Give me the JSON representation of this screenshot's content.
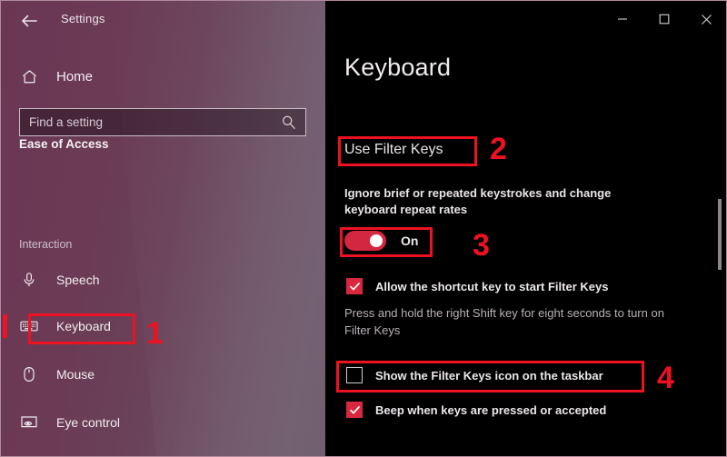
{
  "window": {
    "title": "Settings",
    "back_icon": "back-arrow-icon",
    "controls": [
      {
        "name": "minimize-button",
        "glyph": "—"
      },
      {
        "name": "maximize-button",
        "glyph": "□"
      },
      {
        "name": "close-button",
        "glyph": "✕"
      }
    ]
  },
  "sidebar": {
    "home_label": "Home",
    "home_icon": "home-icon",
    "search": {
      "placeholder": "Find a setting",
      "value": "",
      "icon": "search-icon"
    },
    "section_title": "Ease of Access",
    "group_title": "Interaction",
    "items": [
      {
        "label": "Speech",
        "icon": "microphone-icon",
        "selected": false
      },
      {
        "label": "Keyboard",
        "icon": "keyboard-icon",
        "selected": true
      },
      {
        "label": "Mouse",
        "icon": "mouse-icon",
        "selected": false
      },
      {
        "label": "Eye control",
        "icon": "eye-control-icon",
        "selected": false
      }
    ]
  },
  "main": {
    "page_title": "Keyboard",
    "section_title": "Use Filter Keys",
    "description": "Ignore brief or repeated keystrokes and change keyboard repeat rates",
    "toggle": {
      "state_label": "On",
      "checked": true
    },
    "checkboxes": [
      {
        "label": "Allow the shortcut key to start Filter Keys",
        "checked": true
      },
      {
        "label": "Show the Filter Keys icon on the taskbar",
        "checked": false
      },
      {
        "label": "Beep when keys are pressed or accepted",
        "checked": true
      }
    ],
    "hint": "Press and hold the right Shift key for eight seconds to turn on Filter Keys"
  },
  "annotations": {
    "accent_color": "#ee1122",
    "steps": [
      {
        "number": "1",
        "target": "sidebar-item-keyboard"
      },
      {
        "number": "2",
        "target": "use-filter-keys-heading"
      },
      {
        "number": "3",
        "target": "filter-keys-toggle"
      },
      {
        "number": "4",
        "target": "show-filter-keys-icon-checkbox-row"
      }
    ]
  }
}
